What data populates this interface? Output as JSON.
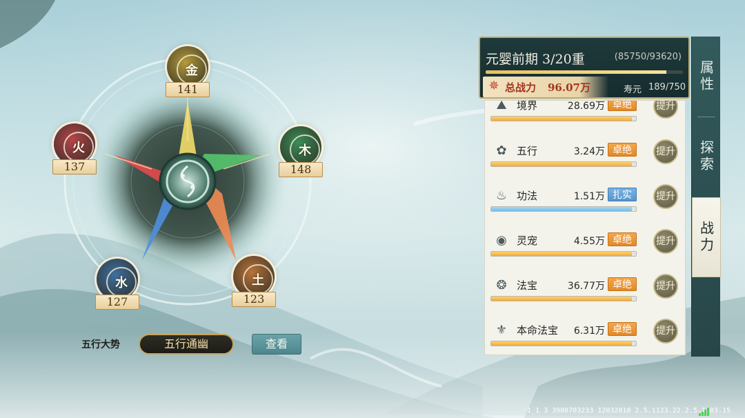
{
  "elements": [
    {
      "key": "metal",
      "glyph": "金",
      "value": "141",
      "color": "#b59b3a",
      "icon": "metal-element-icon"
    },
    {
      "key": "wood",
      "glyph": "木",
      "value": "148",
      "color": "#3d8c57",
      "icon": "wood-element-icon"
    },
    {
      "key": "earth",
      "glyph": "土",
      "value": "123",
      "color": "#b8733a",
      "icon": "earth-element-icon"
    },
    {
      "key": "water",
      "glyph": "水",
      "value": "127",
      "color": "#3f6f9e",
      "icon": "water-element-icon"
    },
    {
      "key": "fire",
      "glyph": "火",
      "value": "137",
      "color": "#b8454a",
      "icon": "fire-element-icon"
    }
  ],
  "five_elements_trend": {
    "label": "五行大势",
    "value": "五行通幽",
    "view_button": "查看"
  },
  "panel": {
    "realm": "元婴前期 3/20重",
    "exp": "(85750/93620)",
    "exp_progress": 0.916,
    "total_power_label": "总战力",
    "total_power_value": "96.07万",
    "lifespan_label": "寿元",
    "lifespan_value": "189/750",
    "upgrade_label": "提升",
    "stats": [
      {
        "name": "境界",
        "value": "28.69万",
        "rank": "卓绝",
        "rank_color": "#e89234",
        "progress": 0.97,
        "bar": "gold",
        "icon": "realm-icon"
      },
      {
        "name": "五行",
        "value": "3.24万",
        "rank": "卓绝",
        "rank_color": "#e89234",
        "progress": 0.97,
        "bar": "gold",
        "icon": "five-elements-icon"
      },
      {
        "name": "功法",
        "value": "1.51万",
        "rank": "扎实",
        "rank_color": "#5f9dd4",
        "progress": 0.97,
        "bar": "blue",
        "icon": "technique-icon"
      },
      {
        "name": "灵宠",
        "value": "4.55万",
        "rank": "卓绝",
        "rank_color": "#e89234",
        "progress": 0.97,
        "bar": "gold",
        "icon": "spirit-pet-icon"
      },
      {
        "name": "法宝",
        "value": "36.77万",
        "rank": "卓绝",
        "rank_color": "#e89234",
        "progress": 0.97,
        "bar": "gold",
        "icon": "magic-treasure-icon"
      },
      {
        "name": "本命法宝",
        "value": "6.31万",
        "rank": "卓绝",
        "rank_color": "#e89234",
        "progress": 0.97,
        "bar": "gold",
        "icon": "natal-treasure-icon"
      }
    ]
  },
  "side_tabs": [
    {
      "label": "属性",
      "active": false
    },
    {
      "label": "探索",
      "active": false
    },
    {
      "label": "战力",
      "active": true
    }
  ],
  "footer": {
    "version": "1_1 3 3900703233 12032010 2.5.1123.22.2.5.1203.15"
  }
}
